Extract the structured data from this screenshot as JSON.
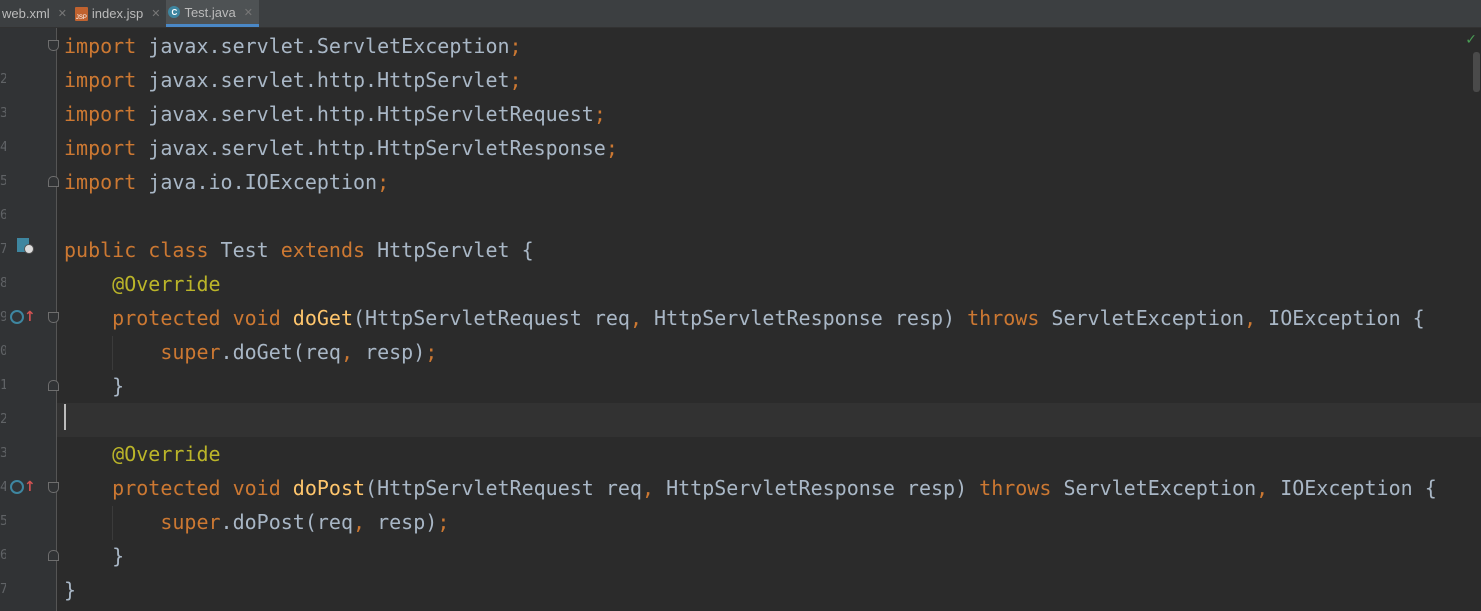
{
  "tabs": [
    {
      "label": "web.xml",
      "icon": "xml-file-icon"
    },
    {
      "label": "index.jsp",
      "icon": "jsp-file-icon",
      "icon_text": "JSP"
    },
    {
      "label": "Test.java",
      "icon": "java-class-icon",
      "icon_text": "C",
      "active": true
    }
  ],
  "editor": {
    "status": "✓",
    "lines": [
      {
        "num": "",
        "tokens": [
          {
            "t": "import",
            "c": "kw"
          },
          {
            "t": " javax.servlet.ServletException",
            "c": ""
          },
          {
            "t": ";",
            "c": "punct"
          }
        ]
      },
      {
        "num": "2",
        "tokens": [
          {
            "t": "import",
            "c": "kw"
          },
          {
            "t": " javax.servlet.http.HttpServlet",
            "c": ""
          },
          {
            "t": ";",
            "c": "punct"
          }
        ]
      },
      {
        "num": "3",
        "tokens": [
          {
            "t": "import",
            "c": "kw"
          },
          {
            "t": " javax.servlet.http.HttpServletRequest",
            "c": ""
          },
          {
            "t": ";",
            "c": "punct"
          }
        ]
      },
      {
        "num": "4",
        "tokens": [
          {
            "t": "import",
            "c": "kw"
          },
          {
            "t": " javax.servlet.http.HttpServletResponse",
            "c": ""
          },
          {
            "t": ";",
            "c": "punct"
          }
        ]
      },
      {
        "num": "5",
        "tokens": [
          {
            "t": "import",
            "c": "kw"
          },
          {
            "t": " java.io.IOException",
            "c": ""
          },
          {
            "t": ";",
            "c": "punct"
          }
        ]
      },
      {
        "num": "6",
        "tokens": []
      },
      {
        "num": "7",
        "tokens": [
          {
            "t": "public class ",
            "c": "kw"
          },
          {
            "t": "Test ",
            "c": ""
          },
          {
            "t": "extends ",
            "c": "kw"
          },
          {
            "t": "HttpServlet {",
            "c": ""
          }
        ]
      },
      {
        "num": "8",
        "tokens": [
          {
            "t": "    @Override",
            "c": "ann"
          }
        ]
      },
      {
        "num": "9",
        "tokens": [
          {
            "t": "    protected void ",
            "c": "kw"
          },
          {
            "t": "doGet",
            "c": "fn"
          },
          {
            "t": "(HttpServletRequest req",
            "c": ""
          },
          {
            "t": ", ",
            "c": "punct"
          },
          {
            "t": "HttpServletResponse resp) ",
            "c": ""
          },
          {
            "t": "throws ",
            "c": "kw"
          },
          {
            "t": "ServletException",
            "c": ""
          },
          {
            "t": ", ",
            "c": "punct"
          },
          {
            "t": "IOException {",
            "c": ""
          }
        ]
      },
      {
        "num": "0",
        "tokens": [
          {
            "t": "        super",
            "c": "kw"
          },
          {
            "t": ".doGet(req",
            "c": ""
          },
          {
            "t": ", ",
            "c": "punct"
          },
          {
            "t": "resp)",
            "c": ""
          },
          {
            "t": ";",
            "c": "punct"
          }
        ]
      },
      {
        "num": "1",
        "tokens": [
          {
            "t": "    }",
            "c": ""
          }
        ]
      },
      {
        "num": "2",
        "tokens": [],
        "current": true
      },
      {
        "num": "3",
        "tokens": [
          {
            "t": "    @Override",
            "c": "ann"
          }
        ]
      },
      {
        "num": "4",
        "tokens": [
          {
            "t": "    protected void ",
            "c": "kw"
          },
          {
            "t": "doPost",
            "c": "fn"
          },
          {
            "t": "(HttpServletRequest req",
            "c": ""
          },
          {
            "t": ", ",
            "c": "punct"
          },
          {
            "t": "HttpServletResponse resp) ",
            "c": ""
          },
          {
            "t": "throws ",
            "c": "kw"
          },
          {
            "t": "ServletException",
            "c": ""
          },
          {
            "t": ", ",
            "c": "punct"
          },
          {
            "t": "IOException {",
            "c": ""
          }
        ]
      },
      {
        "num": "5",
        "tokens": [
          {
            "t": "        super",
            "c": "kw"
          },
          {
            "t": ".doPost(req",
            "c": ""
          },
          {
            "t": ", ",
            "c": "punct"
          },
          {
            "t": "resp)",
            "c": ""
          },
          {
            "t": ";",
            "c": "punct"
          }
        ]
      },
      {
        "num": "6",
        "tokens": [
          {
            "t": "    }",
            "c": ""
          }
        ]
      },
      {
        "num": "7",
        "tokens": [
          {
            "t": "}",
            "c": ""
          }
        ]
      }
    ]
  },
  "colors": {
    "background": "#2b2b2b",
    "keyword": "#cc7832",
    "annotation": "#bbb529",
    "method": "#ffc66d",
    "text": "#a9b7c6"
  }
}
